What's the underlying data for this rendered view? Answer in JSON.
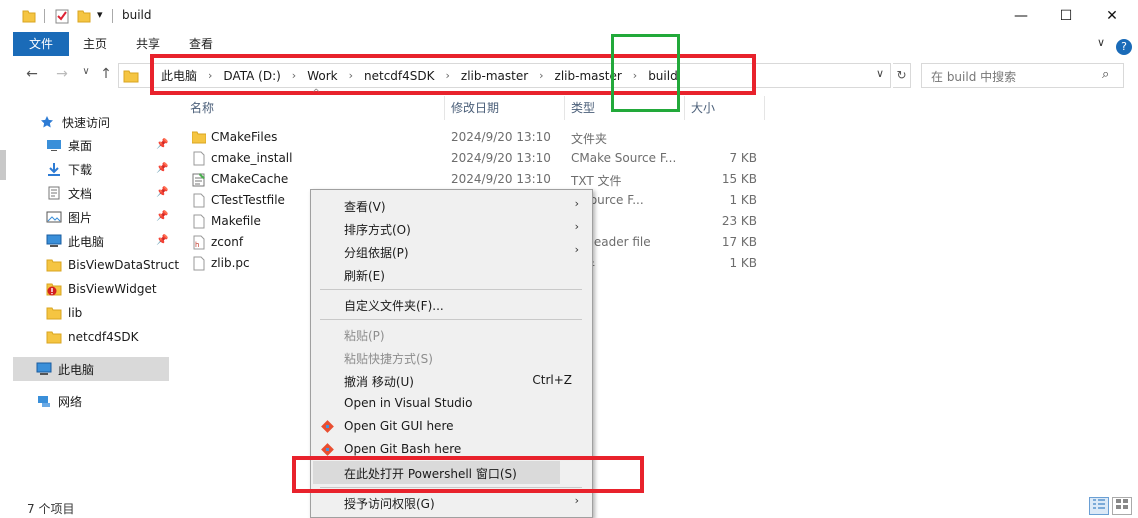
{
  "window": {
    "title": "build",
    "minimize": "—",
    "maximize": "☐",
    "close": "✕"
  },
  "ribbon": {
    "tabs": [
      "文件",
      "主页",
      "共享",
      "查看"
    ],
    "expand": "∨",
    "help": "?"
  },
  "nav": {
    "back": "←",
    "forward": "→",
    "recent": "∨",
    "up": "↑"
  },
  "address": {
    "crumbs": [
      "此电脑",
      "DATA (D:)",
      "Work",
      "netcdf4SDK",
      "zlib-master",
      "zlib-master",
      "build"
    ],
    "separator": "›",
    "dropdown": "∨",
    "refresh": "↻"
  },
  "search": {
    "placeholder": "在 build 中搜索",
    "icon": "⌕"
  },
  "sidebar": {
    "quick_access": "快速访问",
    "items": [
      {
        "label": "桌面",
        "icon": "desktop-icon",
        "pinned": true
      },
      {
        "label": "下载",
        "icon": "download-icon",
        "pinned": true
      },
      {
        "label": "文档",
        "icon": "document-icon",
        "pinned": true
      },
      {
        "label": "图片",
        "icon": "picture-icon",
        "pinned": true
      },
      {
        "label": "此电脑",
        "icon": "computer-icon",
        "pinned": true
      },
      {
        "label": "BisViewDataStruct",
        "icon": "folder-icon",
        "pinned": false
      },
      {
        "label": "BisViewWidget",
        "icon": "error-folder-icon",
        "pinned": false
      },
      {
        "label": "lib",
        "icon": "folder-icon",
        "pinned": false
      },
      {
        "label": "netcdf4SDK",
        "icon": "folder-icon",
        "pinned": false
      }
    ],
    "this_pc": "此电脑",
    "network": "网络",
    "pin_glyph": "📌"
  },
  "columns": {
    "name": "名称",
    "date": "修改日期",
    "type": "类型",
    "size": "大小",
    "sort_glyph": "^"
  },
  "files": [
    {
      "name": "CMakeFiles",
      "date": "2024/9/20 13:10",
      "type": "文件夹",
      "size": "",
      "icon": "folder-icon"
    },
    {
      "name": "cmake_install",
      "date": "2024/9/20 13:10",
      "type": "CMake Source F...",
      "size": "7 KB",
      "icon": "file-icon"
    },
    {
      "name": "CMakeCache",
      "date": "2024/9/20 13:10",
      "type": "TXT 文件",
      "size": "15 KB",
      "icon": "text-file-icon"
    },
    {
      "name": "CTestTestfile",
      "date": "",
      "type": "e Source F...",
      "size": "1 KB",
      "icon": "file-icon"
    },
    {
      "name": "Makefile",
      "date": "",
      "type": "",
      "size": "23 KB",
      "icon": "file-icon"
    },
    {
      "name": "zconf",
      "date": "",
      "type": "+ Header file",
      "size": "17 KB",
      "icon": "header-file-icon"
    },
    {
      "name": "zlib.pc",
      "date": "",
      "type": "文件",
      "size": "1 KB",
      "icon": "file-icon"
    }
  ],
  "context_menu": {
    "items": [
      {
        "label": "查看(V)",
        "submenu": true,
        "disabled": false
      },
      {
        "label": "排序方式(O)",
        "submenu": true,
        "disabled": false
      },
      {
        "label": "分组依据(P)",
        "submenu": true,
        "disabled": false
      },
      {
        "label": "刷新(E)",
        "submenu": false,
        "disabled": false
      },
      {
        "label": "自定义文件夹(F)...",
        "submenu": false,
        "disabled": false
      },
      {
        "label": "粘贴(P)",
        "submenu": false,
        "disabled": true
      },
      {
        "label": "粘贴快捷方式(S)",
        "submenu": false,
        "disabled": true
      },
      {
        "label": "撤消 移动(U)",
        "shortcut": "Ctrl+Z",
        "submenu": false,
        "disabled": false
      },
      {
        "label": "Open in Visual Studio",
        "submenu": false,
        "disabled": false
      },
      {
        "label": "Open Git GUI here",
        "submenu": false,
        "disabled": false,
        "icon": "git-icon"
      },
      {
        "label": "Open Git Bash here",
        "submenu": false,
        "disabled": false,
        "icon": "git-icon"
      },
      {
        "label": "在此处打开 Powershell 窗口(S)",
        "submenu": false,
        "disabled": false,
        "highlighted": true
      },
      {
        "label": "授予访问权限(G)",
        "submenu": true,
        "disabled": false
      }
    ],
    "arrow": "›"
  },
  "status": {
    "item_count": "7 个项目"
  },
  "colors": {
    "accent": "#1a6bb8",
    "highlight_red": "#e8222c",
    "highlight_green": "#22a93a",
    "folder": "#f5c542"
  }
}
